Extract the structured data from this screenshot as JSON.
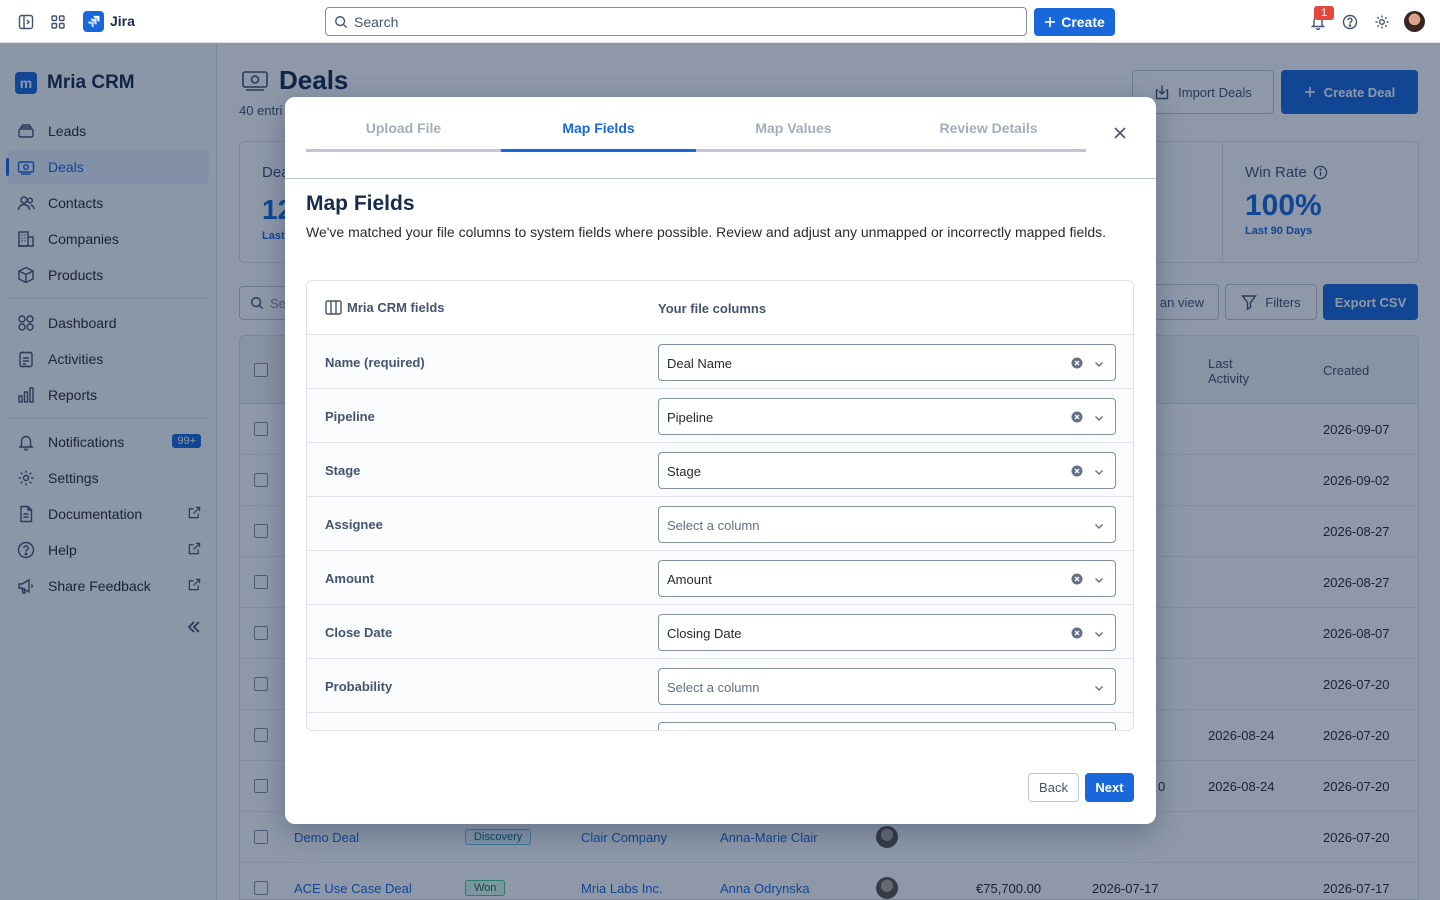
{
  "topbar": {
    "app_name": "Jira",
    "search_placeholder": "Search",
    "create_label": "Create",
    "notification_count": "1"
  },
  "sidebar": {
    "brand": "Mria CRM",
    "brand_logo": "m",
    "items": [
      {
        "label": "Leads",
        "icon": "leads-icon"
      },
      {
        "label": "Deals",
        "icon": "deals-icon",
        "active": true
      },
      {
        "label": "Contacts",
        "icon": "contacts-icon"
      },
      {
        "label": "Companies",
        "icon": "companies-icon"
      },
      {
        "label": "Products",
        "icon": "products-icon"
      }
    ],
    "items2": [
      {
        "label": "Dashboard",
        "icon": "dashboard-icon"
      },
      {
        "label": "Activities",
        "icon": "activities-icon"
      },
      {
        "label": "Reports",
        "icon": "reports-icon"
      }
    ],
    "items3": [
      {
        "label": "Notifications",
        "badge": "99+"
      },
      {
        "label": "Settings"
      },
      {
        "label": "Documentation"
      },
      {
        "label": "Help"
      },
      {
        "label": "Share Feedback"
      }
    ]
  },
  "main": {
    "title": "Deals",
    "entries": "40 entri",
    "import_label": "Import Deals",
    "create_label": "Create Deal",
    "stat_peek": {
      "label": "Dea",
      "value": "12",
      "sub": "Last"
    },
    "win_rate": {
      "label": "Win Rate",
      "value": "100%",
      "sub": "Last 90 Days"
    },
    "search_peek": "Se",
    "view_peek": "an view",
    "filters_label": "Filters",
    "export_label": "Export CSV",
    "columns": {
      "last_activity": "Last Activity",
      "created": "Created"
    },
    "rows": [
      {
        "created": "2026-09-07"
      },
      {
        "created": "2026-09-02"
      },
      {
        "created": "2026-08-27"
      },
      {
        "created": "2026-08-27"
      },
      {
        "created": "2026-08-07"
      },
      {
        "created": "2026-07-20"
      },
      {
        "last_activity": "2026-08-24",
        "created": "2026-07-20"
      },
      {
        "amount_peek": "0",
        "last_activity": "2026-08-24",
        "created": "2026-07-20"
      },
      {
        "name": "Demo Deal",
        "stage": "Discovery",
        "company": "Clair Company",
        "contact": "Anna-Marie Clair",
        "created": "2026-07-20"
      },
      {
        "name": "ACE Use Case Deal",
        "stage": "Won",
        "company": "Mria Labs Inc.",
        "contact": "Anna Odrynska",
        "amount": "€75,700.00",
        "close": "2026-07-17",
        "created": "2026-07-17"
      }
    ]
  },
  "modal": {
    "steps": [
      "Upload File",
      "Map Fields",
      "Map Values",
      "Review Details"
    ],
    "active_step": 1,
    "title": "Map Fields",
    "description": "We've matched your file columns to system fields where possible. Review and adjust any unmapped or incorrectly mapped fields.",
    "col_crm": "Mria CRM fields",
    "col_file": "Your file columns",
    "mappings": [
      {
        "field": "Name (required)",
        "value": "Deal Name",
        "placeholder": false
      },
      {
        "field": "Pipeline",
        "value": "Pipeline",
        "placeholder": false
      },
      {
        "field": "Stage",
        "value": "Stage",
        "placeholder": false
      },
      {
        "field": "Assignee",
        "value": "Select a column",
        "placeholder": true
      },
      {
        "field": "Amount",
        "value": "Amount",
        "placeholder": false
      },
      {
        "field": "Close Date",
        "value": "Closing Date",
        "placeholder": false
      },
      {
        "field": "Probability",
        "value": "Select a column",
        "placeholder": true
      }
    ],
    "back_label": "Back",
    "next_label": "Next"
  }
}
